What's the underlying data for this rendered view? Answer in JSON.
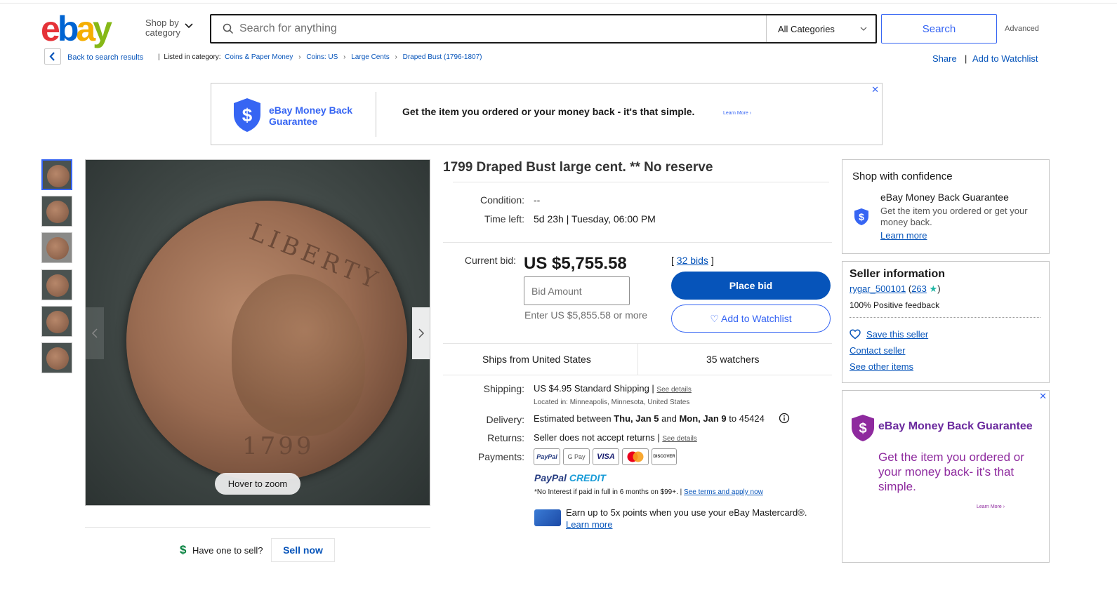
{
  "header": {
    "logo": {
      "e": "e",
      "b": "b",
      "a": "a",
      "y": "y"
    },
    "shop_by_category": "Shop by category",
    "search_placeholder": "Search for anything",
    "category_select": "All Categories",
    "search_button": "Search",
    "advanced": "Advanced"
  },
  "breadcrumb": {
    "back": "Back to search results",
    "listed_in": "Listed in category:",
    "items": [
      "Coins & Paper Money",
      "Coins: US",
      "Large Cents",
      "Draped Bust (1796-1807)"
    ],
    "share": "Share",
    "add_to_watchlist": "Add to Watchlist"
  },
  "top_ad": {
    "brand": "eBay Money Back Guarantee",
    "message": "Get the item you ordered or your money back - it's that simple.",
    "learn_more": "Learn More ›",
    "close": "✕"
  },
  "image": {
    "thumbnail_count": 6,
    "hover_zoom": "Hover to zoom",
    "coin_legend": "LIBERTY",
    "coin_date": "1799"
  },
  "sell": {
    "have_one": "Have one to sell?",
    "sell_now": "Sell now"
  },
  "item": {
    "title": "1799 Draped Bust large cent. ** No reserve",
    "condition_label": "Condition:",
    "condition_value": "--",
    "time_left_label": "Time left:",
    "time_left_value": "5d 23h | Tuesday, 06:00 PM",
    "current_bid_label": "Current bid:",
    "current_bid": "US $5,755.58",
    "bids_open": "[",
    "bids": "32 bids",
    "bids_close": "]",
    "bid_placeholder": "Bid Amount",
    "enter_more": "Enter US $5,855.58 or more",
    "place_bid": "Place bid",
    "add_to_watchlist": "♡ Add to Watchlist",
    "ships_from": "Ships from United States",
    "watchers": "35 watchers"
  },
  "shipping": {
    "shipping_label": "Shipping:",
    "shipping_price": "US $4.95",
    "shipping_type": "Standard Shipping |",
    "see_details": "See details",
    "located": "Located in: Minneapolis, Minnesota, United States",
    "delivery_label": "Delivery:",
    "delivery_pre": "Estimated between",
    "delivery_start": "Thu, Jan 5",
    "delivery_and": "and",
    "delivery_end": "Mon, Jan 9",
    "delivery_zip": "to 45424",
    "returns_label": "Returns:",
    "returns_value": "Seller does not accept returns |",
    "returns_details": "See details",
    "payments_label": "Payments:",
    "payments": [
      "PayPal",
      "G Pay",
      "VISA",
      "",
      "DISCOVER"
    ],
    "paypal_credit_a": "PayPal",
    "paypal_credit_b": "CREDIT",
    "no_interest": "*No Interest if paid in full in 6 months on $99+. |",
    "terms": "See terms and apply now",
    "earn": "Earn up to 5x points when you use your eBay Mastercard®.",
    "earn_learn": "Learn more"
  },
  "confidence": {
    "title": "Shop with confidence",
    "mbg": "eBay Money Back Guarantee",
    "desc": "Get the item you ordered or get your money back.",
    "learn": "Learn more"
  },
  "seller": {
    "title": "Seller information",
    "name": "rygar_500101",
    "feedback_open": "(",
    "feedback_count": "263",
    "feedback_close": ")",
    "positive": "100% Positive feedback",
    "save": "Save this seller",
    "contact": "Contact seller",
    "other": "See other items"
  },
  "side_ad": {
    "title": "eBay Money Back Guarantee",
    "message": "Get the item you ordered or your money back- it's that simple.",
    "learn_more": "Learn More ›",
    "close": "✕"
  },
  "colors": {
    "brand_blue": "#3665f3",
    "link_blue": "#0654ba",
    "bid_button": "#0654ba",
    "ad_purple": "#6b2a9e"
  }
}
